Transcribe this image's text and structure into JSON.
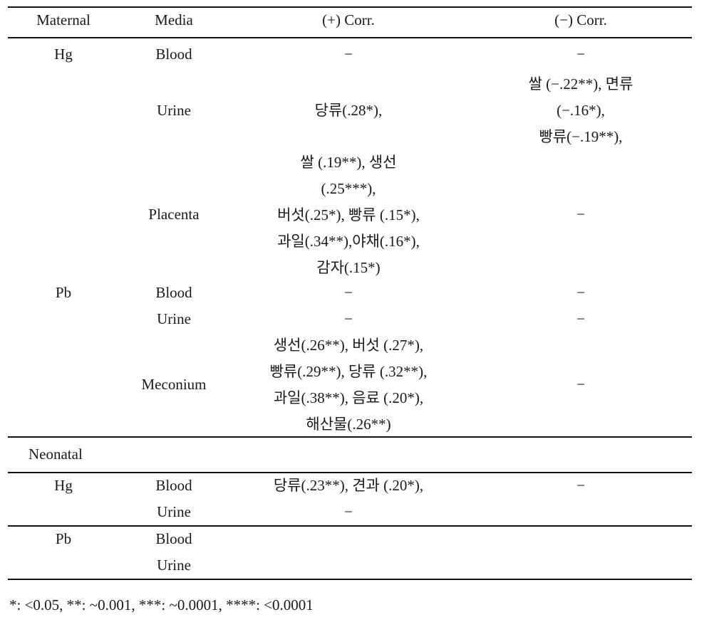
{
  "table": {
    "headers": {
      "group": "Maternal",
      "media": "Media",
      "pos": "(+) Corr.",
      "neg": "(−) Corr."
    },
    "maternal": {
      "hg": {
        "label": "Hg",
        "blood": {
          "media": "Blood",
          "pos": "−",
          "neg": "−"
        },
        "urine": {
          "media": "Urine",
          "pos": "당류(.28*),",
          "neg": [
            "쌀  (−.22**),     면류",
            "(−.16*),",
            "빵류(−.19**),"
          ]
        },
        "placenta": {
          "media": "Placenta",
          "pos": [
            "쌀  (.19**),     생선",
            "(.25***),",
            "버섯(.25*),  빵류 (.15*),",
            "과일(.34**),야채(.16*),",
            "감자(.15*)"
          ],
          "neg": "−"
        }
      },
      "pb": {
        "label": "Pb",
        "blood": {
          "media": "Blood",
          "pos": "−",
          "neg": "−"
        },
        "urine": {
          "media": "Urine",
          "pos": "−",
          "neg": "−"
        },
        "meconium": {
          "media": "Meconium",
          "pos": [
            "생선(.26**),  버섯 (.27*),",
            "빵류(.29**),  당류 (.32**),",
            "과일(.38**),  음료 (.20*),",
            "해산물(.26**)"
          ],
          "neg": "−"
        }
      }
    },
    "neonatal": {
      "label": "Neonatal",
      "hg": {
        "label": "Hg",
        "blood": {
          "media": "Blood",
          "pos": "당류(.23**),  견과 (.20*),",
          "neg": "−"
        },
        "urine": {
          "media": "Urine",
          "pos": "−"
        }
      },
      "pb": {
        "label": "Pb",
        "blood": {
          "media": "Blood"
        },
        "urine": {
          "media": "Urine"
        }
      }
    }
  },
  "footnote": "*: <0.05, **: ~0.001, ***: ~0.0001, ****: <0.0001"
}
